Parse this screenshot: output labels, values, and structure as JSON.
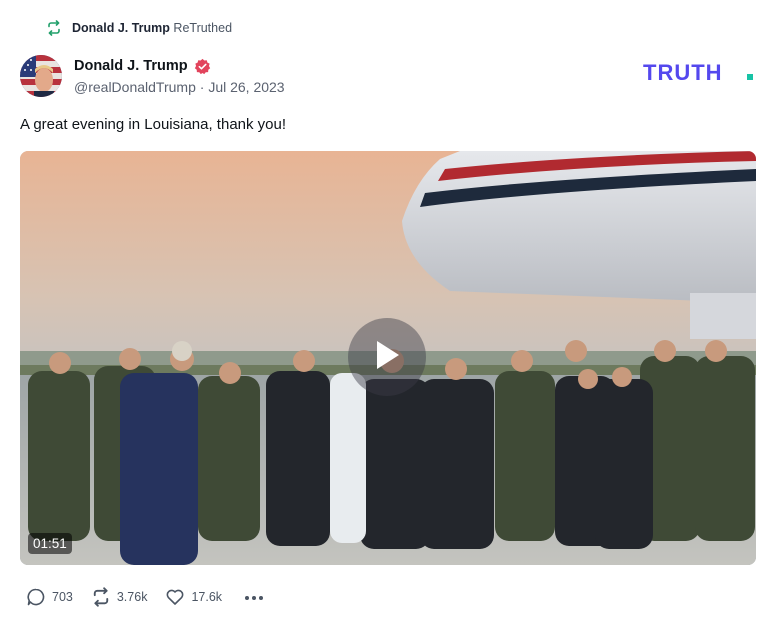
{
  "retruth": {
    "name": "Donald J. Trump",
    "label": "ReTruthed",
    "icon": "retruth-icon",
    "accent": "#22a06b"
  },
  "post": {
    "author_name": "Donald J. Trump",
    "verified_icon": "verified-badge-icon",
    "handle": "@realDonaldTrump",
    "separator": "·",
    "date": "Jul 26, 2023",
    "text": "A great evening in Louisiana, thank you!",
    "brand": "TRUTH.",
    "brand_color": "#5448ee",
    "brand_dot_color": "#17c3a6"
  },
  "media": {
    "type": "video",
    "duration": "01:51",
    "play_icon": "play-icon"
  },
  "actions": {
    "replies": "703",
    "retruths": "3.76k",
    "likes": "17.6k",
    "more_icon": "more-icon"
  }
}
